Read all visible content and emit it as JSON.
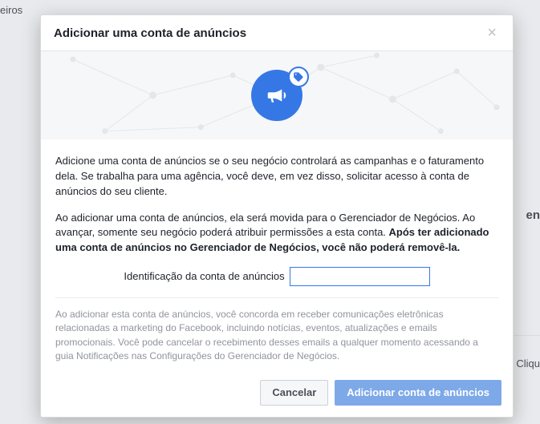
{
  "bg": {
    "top_left": "eiros",
    "right1": "en",
    "right2": "Cliqu"
  },
  "modal": {
    "title": "Adicionar uma conta de anúncios",
    "close": "×",
    "body": {
      "p1": "Adicione uma conta de anúncios se o seu negócio controlará as campanhas e o faturamento dela. Se trabalha para uma agência, você deve, em vez disso, solicitar acesso à conta de anúncios do seu cliente.",
      "p2a": "Ao adicionar uma conta de anúncios, ela será movida para o Gerenciador de Negócios. Ao avançar, somente seu negócio poderá atribuir permissões a esta conta. ",
      "p2b": "Após ter adicionado uma conta de anúncios no Gerenciador de Negócios, você não poderá removê-la.",
      "field_label": "Identificação da conta de anúncios",
      "field_value": "",
      "disclaimer": "Ao adicionar esta conta de anúncios, você concorda em receber comunicações eletrônicas relacionadas a marketing do Facebook, incluindo notícias, eventos, atualizações e emails promocionais. Você pode cancelar o recebimento desses emails a qualquer momento acessando a guia Notificações nas Configurações do Gerenciador de Negócios."
    },
    "footer": {
      "cancel": "Cancelar",
      "submit": "Adicionar conta de anúncios"
    }
  },
  "colors": {
    "accent": "#3578e5",
    "hero_bg": "#f6f7f9"
  }
}
